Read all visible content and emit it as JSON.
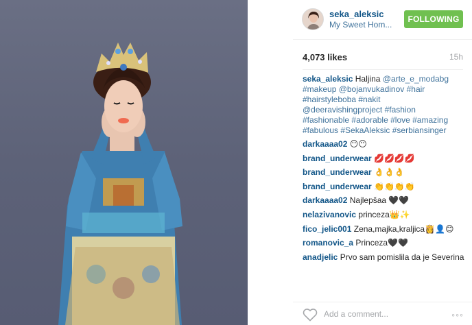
{
  "post": {
    "username": "seka_aleksic",
    "location": "My Sweet Hom...",
    "follow_label": "FOLLOWING",
    "likes": "4,073 likes",
    "time_ago": "15h",
    "caption_lines": [
      {
        "user": "seka_aleksic",
        "text": " Haljina ",
        "link": "@arte_e_modabg"
      },
      {
        "text": "#makeup @bojanvukadinov #hair"
      },
      {
        "text": "#hairstyleboba #nakit"
      },
      {
        "text": "@deeravishingproject #fashion"
      },
      {
        "text": "#fashionable #adorable #love #amazing"
      },
      {
        "text": "#fabulous #SekaAleksic #serbiansinger"
      }
    ],
    "comments": [
      {
        "user": "darkaaaa02",
        "text": "😶😶"
      },
      {
        "user": "brand_underwear",
        "text": "💋💋💋💋"
      },
      {
        "user": "brand_underwear",
        "text": "👌👌👌"
      },
      {
        "user": "brand_underwear",
        "text": "👏👏👏👏"
      },
      {
        "user": "darkaaaa02",
        "text": "Najlepšaa 🖤🖤"
      },
      {
        "user": "nelazivanovic",
        "text": "princeza👑✨"
      },
      {
        "user": "fico_jelic001",
        "text": "Zena,majka,kraljica👸👤😊"
      },
      {
        "user": "romanovic_a",
        "text": "Princeza🖤🖤"
      },
      {
        "user": "anadjelic",
        "text": "Prvo sam pomislila da je Severina"
      }
    ],
    "add_comment_placeholder": "Add a comment...",
    "more_label": "◦◦◦"
  },
  "colors": {
    "username": "#125688",
    "link": "#3f729b",
    "follow_bg": "#70c050",
    "muted": "#a5a7aa",
    "photo_bg": "#5d6278"
  },
  "icons": {
    "like": "heart-outline-icon",
    "more": "ellipsis-icon"
  }
}
